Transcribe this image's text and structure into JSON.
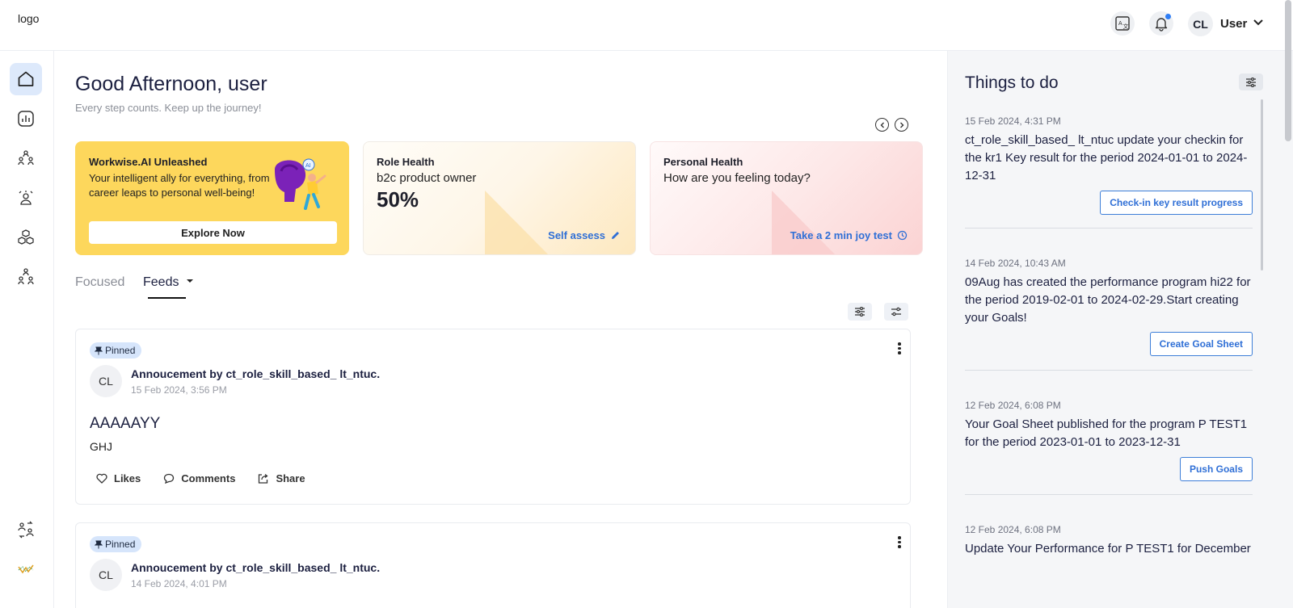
{
  "header": {
    "logo": "logo",
    "user_initials": "CL",
    "user_name": "User"
  },
  "main": {
    "greeting": "Good Afternoon, user",
    "subtitle": "Every step counts. Keep up the journey!",
    "cards": {
      "ai": {
        "title": "Workwise.AI Unleashed",
        "description": "Your intelligent ally for everything, from career leaps to personal well-being!",
        "button": "Explore Now",
        "badge": "AI"
      },
      "role": {
        "title": "Role Health",
        "subtitle": "b2c product owner",
        "value": "50%",
        "link": "Self assess"
      },
      "personal": {
        "title": "Personal Health",
        "subtitle": "How are you feeling today?",
        "link": "Take a 2 min joy test"
      }
    },
    "tabs": {
      "focused": "Focused",
      "feeds": "Feeds"
    },
    "posts": [
      {
        "pinned": "Pinned",
        "avatar": "CL",
        "author": "Annoucement by ct_role_skill_based_ lt_ntuc.",
        "time": "15 Feb 2024, 3:56 PM",
        "heading": "AAAAAYY",
        "body": "GHJ",
        "likes": "Likes",
        "comments": "Comments",
        "share": "Share"
      },
      {
        "pinned": "Pinned",
        "avatar": "CL",
        "author": "Annoucement by ct_role_skill_based_ lt_ntuc.",
        "time": "14 Feb 2024, 4:01 PM"
      }
    ]
  },
  "todo": {
    "title": "Things to do",
    "items": [
      {
        "date": "15 Feb 2024, 4:31 PM",
        "text": "ct_role_skill_based_ lt_ntuc update your checkin for the kr1 Key result for the period 2024-01-01 to 2024-12-31",
        "button": "Check-in key result progress"
      },
      {
        "date": "14 Feb 2024, 10:43 AM",
        "text": "09Aug has created the performance program hi22 for the period 2019-02-01 to 2024-02-29.Start creating your Goals!",
        "button": "Create Goal Sheet"
      },
      {
        "date": "12 Feb 2024, 6:08 PM",
        "text": "Your Goal Sheet published for the program P TEST1 for the period 2023-01-01 to 2023-12-31",
        "button": "Push Goals"
      },
      {
        "date": "12 Feb 2024, 6:08 PM",
        "text": "Update Your Performance for P TEST1 for December"
      }
    ]
  },
  "colors": {
    "accent": "#2f6fd6",
    "ai_card": "#fdd75c",
    "active_nav": "#dde9fb",
    "panel_bg": "#f5f6f8"
  },
  "icons": {
    "rail": [
      "home-icon",
      "analytics-icon",
      "team-icon",
      "people-icon",
      "cubes-icon",
      "hierarchy-icon",
      "swap-users-icon",
      "trend-icon"
    ]
  }
}
